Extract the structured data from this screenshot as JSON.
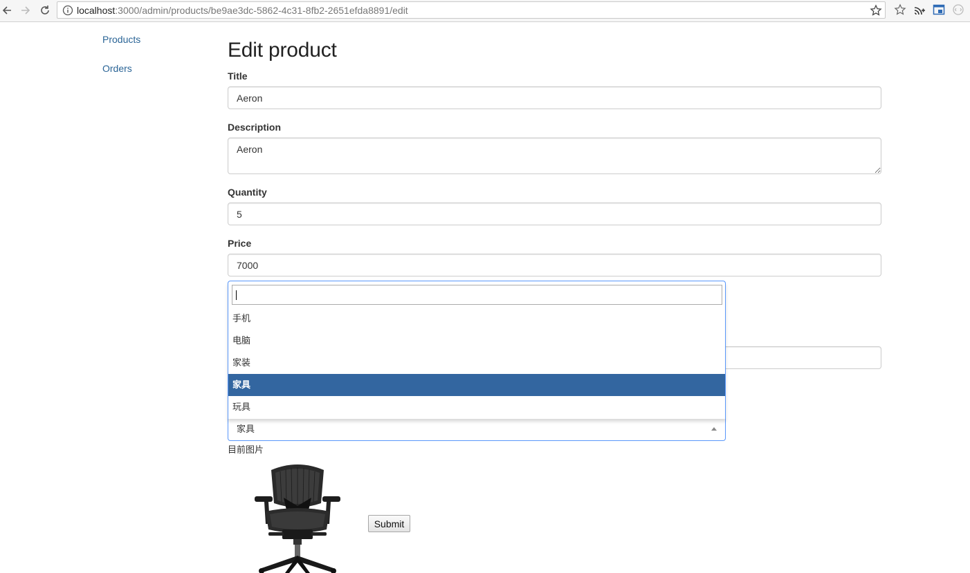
{
  "browser": {
    "url_host": "localhost",
    "url_path": ":3000/admin/products/be9ae3dc-5862-4c31-8fb2-2651efda8891/edit",
    "icons": [
      "back-icon",
      "forward-icon",
      "reload-icon",
      "info-icon",
      "bookmark-star-icon",
      "extension-star-icon",
      "cast-icon",
      "window-icon",
      "sync-icon"
    ]
  },
  "sidebar": {
    "items": [
      {
        "label": "Products"
      },
      {
        "label": "Orders"
      }
    ]
  },
  "main": {
    "title": "Edit product",
    "fields": {
      "title": {
        "label": "Title",
        "value": "Aeron"
      },
      "description": {
        "label": "Description",
        "value": "Aeron"
      },
      "quantity": {
        "label": "Quantity",
        "value": "5"
      },
      "price": {
        "label": "Price",
        "value": "7000"
      }
    },
    "category": {
      "selected": "家具",
      "search_value": "",
      "options": [
        "手机",
        "电脑",
        "家装",
        "家具",
        "玩具"
      ],
      "highlighted_index": 3
    },
    "current_image_label": "目前图片",
    "submit_label": "Submit"
  },
  "colors": {
    "link": "#2a6496",
    "highlight": "#3366a0",
    "focus_border": "#5897fb"
  }
}
